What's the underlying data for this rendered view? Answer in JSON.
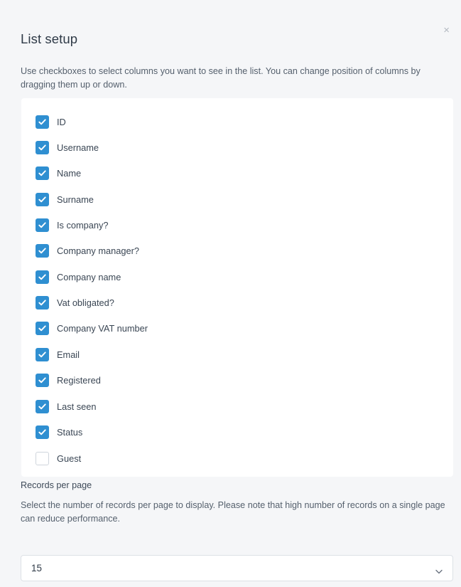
{
  "dialog": {
    "title": "List setup",
    "close_label": "×",
    "intro": "Use checkboxes to select columns you want to see in the list. You can change position of columns by dragging them up or down."
  },
  "columns": [
    {
      "label": "ID",
      "checked": true
    },
    {
      "label": "Username",
      "checked": true
    },
    {
      "label": "Name",
      "checked": true
    },
    {
      "label": "Surname",
      "checked": true
    },
    {
      "label": "Is company?",
      "checked": true
    },
    {
      "label": "Company manager?",
      "checked": true
    },
    {
      "label": "Company name",
      "checked": true
    },
    {
      "label": "Vat obligated?",
      "checked": true
    },
    {
      "label": "Company VAT number",
      "checked": true
    },
    {
      "label": "Email",
      "checked": true
    },
    {
      "label": "Registered",
      "checked": true
    },
    {
      "label": "Last seen",
      "checked": true
    },
    {
      "label": "Status",
      "checked": true
    },
    {
      "label": "Guest",
      "checked": false
    }
  ],
  "records_per_page": {
    "label": "Records per page",
    "help": "Select the number of records per page to display. Please note that high number of records on a single page can reduce performance.",
    "value": "15"
  },
  "icons": {
    "checkbox_checked": "check-icon",
    "select_arrow": "chevron-down-icon",
    "close": "close-icon"
  },
  "colors": {
    "accent": "#2f8fd1",
    "panel": "#ffffff",
    "background": "#f5f6f8"
  }
}
